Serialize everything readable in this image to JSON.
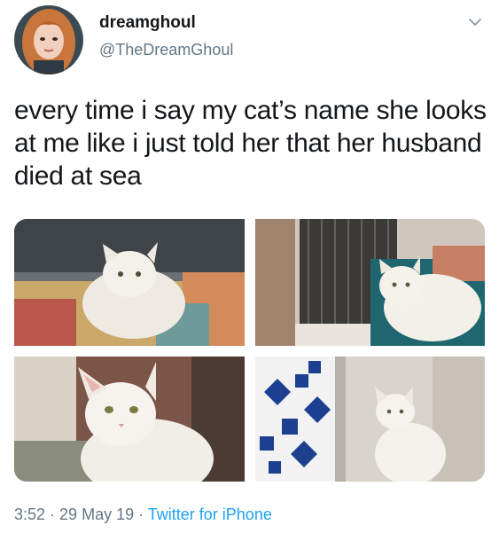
{
  "user": {
    "display_name": "dreamghoul",
    "handle": "@TheDreamGhoul",
    "avatar_icon": "profile-avatar"
  },
  "tweet": {
    "text": "every time i say my cat’s name she looks at me like i just told her that her husband died at sea"
  },
  "media": {
    "photo_count": 4,
    "photos": [
      {
        "subject": "white cat on patchwork quilt"
      },
      {
        "subject": "white cat on teal couch by crate"
      },
      {
        "subject": "white cat close-up"
      },
      {
        "subject": "white cat sitting by patterned curtain"
      }
    ]
  },
  "meta": {
    "time": "3:52",
    "separator": " · ",
    "date": "29 May 19",
    "source": "Twitter for iPhone"
  },
  "colors": {
    "text": "#14171a",
    "secondary": "#657786",
    "link": "#1da1f2"
  }
}
